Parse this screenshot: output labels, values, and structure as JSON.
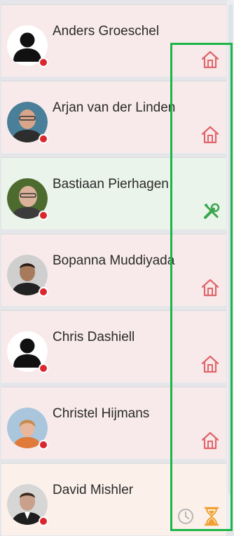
{
  "colors": {
    "presence_busy": "#d9272e",
    "home_icon": "#e0656b",
    "work_icon": "#3aa54c",
    "pending_icon": "#f0a030",
    "clock_icon": "#b5b5b5",
    "highlight_border": "#1cb54a"
  },
  "contacts": [
    {
      "name": "Anders Groeschel",
      "avatar": "default-person-icon",
      "presence": "busy",
      "status": "home-icon"
    },
    {
      "name": "Arjan van der Linden",
      "avatar": "photo",
      "presence": "busy",
      "status": "home-icon"
    },
    {
      "name": "Bastiaan Pierhagen",
      "avatar": "photo",
      "presence": "busy",
      "status": "tools-icon"
    },
    {
      "name": "Bopanna Muddiyada",
      "avatar": "photo",
      "presence": "busy",
      "status": "home-icon"
    },
    {
      "name": "Chris Dashiell",
      "avatar": "default-person-icon",
      "presence": "busy",
      "status": "home-icon"
    },
    {
      "name": "Christel Hijmans",
      "avatar": "photo",
      "presence": "busy",
      "status": "home-icon"
    },
    {
      "name": "David Mishler",
      "avatar": "photo",
      "presence": "busy",
      "status": "hourglass-icon"
    }
  ]
}
